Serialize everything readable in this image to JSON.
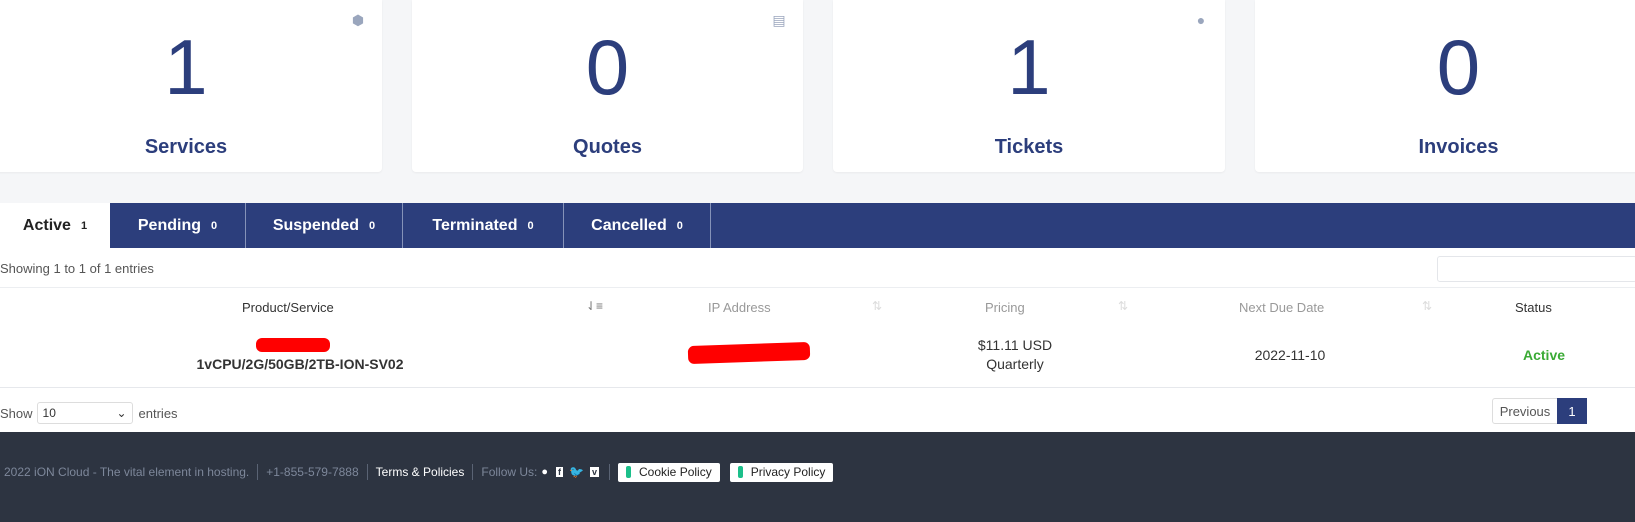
{
  "cards": [
    {
      "value": "1",
      "label": "Services",
      "icon": "cube-icon"
    },
    {
      "value": "0",
      "label": "Quotes",
      "icon": "document-icon"
    },
    {
      "value": "1",
      "label": "Tickets",
      "icon": "comments-icon"
    },
    {
      "value": "0",
      "label": "Invoices",
      "icon": "credit-card-icon"
    }
  ],
  "tabs": [
    {
      "label": "Active",
      "count": "1"
    },
    {
      "label": "Pending",
      "count": "0"
    },
    {
      "label": "Suspended",
      "count": "0"
    },
    {
      "label": "Terminated",
      "count": "0"
    },
    {
      "label": "Cancelled",
      "count": "0"
    }
  ],
  "table": {
    "info": "Showing 1 to 1 of 1 entries",
    "search_value": "",
    "columns": [
      "Product/Service",
      "IP Address",
      "Pricing",
      "Next Due Date",
      "Status"
    ],
    "rows": [
      {
        "product": "1vCPU/2G/50GB/2TB-ION-SV02",
        "price": "$11.11 USD",
        "cycle": "Quarterly",
        "due": "2022-11-10",
        "status": "Active"
      }
    ],
    "show_label": "Show",
    "page_size": "10",
    "entries_label": "entries",
    "previous": "Previous",
    "page": "1"
  },
  "colors": {
    "brand": "#2c3e7c",
    "active": "#3aaa35",
    "footer": "#2d3441"
  },
  "footer": {
    "copyright": "2022 iON Cloud - The vital element in hosting.",
    "phone": "+1-855-579-7888",
    "terms": "Terms & Policies",
    "follow": "Follow Us:",
    "cookie": "Cookie Policy",
    "privacy": "Privacy Policy"
  }
}
